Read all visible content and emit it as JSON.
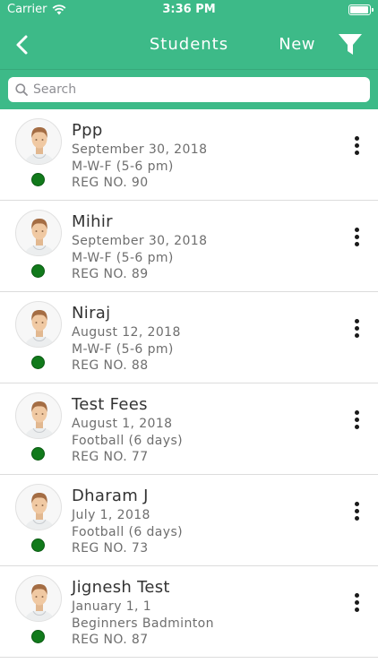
{
  "status_bar": {
    "carrier": "Carrier",
    "time": "3:36 PM",
    "battery_level": 1.0
  },
  "nav": {
    "title": "Students",
    "new_label": "New",
    "back_icon": "chevron-left-icon",
    "filter_icon": "filter-icon"
  },
  "search": {
    "placeholder": "Search",
    "value": ""
  },
  "colors": {
    "header": "#3dba88",
    "active_dot": "#117a1b"
  },
  "students": [
    {
      "name": "Ppp",
      "date": "September 30, 2018",
      "batch": "M-W-F (5-6 pm)",
      "reg": "REG NO. 90",
      "status": "active"
    },
    {
      "name": "Mihir",
      "date": "September 30, 2018",
      "batch": "M-W-F (5-6 pm)",
      "reg": "REG NO. 89",
      "status": "active"
    },
    {
      "name": "Niraj",
      "date": "August 12, 2018",
      "batch": "M-W-F (5-6 pm)",
      "reg": "REG NO. 88",
      "status": "active"
    },
    {
      "name": "Test Fees",
      "date": "August 1, 2018",
      "batch": "Football (6 days)",
      "reg": "REG NO. 77",
      "status": "active"
    },
    {
      "name": "Dharam J",
      "date": "July 1, 2018",
      "batch": "Football (6 days)",
      "reg": "REG NO. 73",
      "status": "active"
    },
    {
      "name": "Jignesh Test",
      "date": "January 1, 1",
      "batch": "Beginners Badminton",
      "reg": "REG NO. 87",
      "status": "active"
    }
  ]
}
